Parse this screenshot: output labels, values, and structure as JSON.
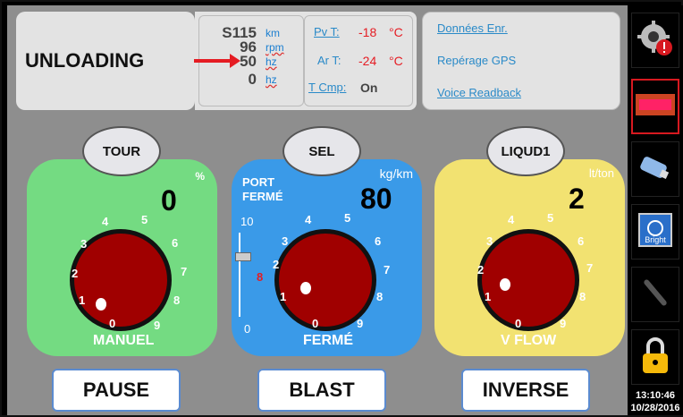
{
  "status": {
    "mode": "UNLOADING"
  },
  "readouts": {
    "speed_value": "S115",
    "speed_unit": "km",
    "rpm_value": "96",
    "rpm_unit": "rpm",
    "hz_value": "50",
    "hz_unit": "hz",
    "hz2_value": "0",
    "hz2_unit": "hz",
    "pvt_label": "Pv T:",
    "pvt_value": "-18",
    "pvt_unit": "°C",
    "art_label": "Ar T:",
    "art_value": "-24",
    "art_unit": "°C",
    "tcmp_label": "T Cmp:",
    "tcmp_value": "On"
  },
  "links": {
    "data": "Données Enr.",
    "gps": "Repérage GPS",
    "voice": "Voice Readback"
  },
  "sidebar": {
    "time": "13:10:46",
    "date": "10/28/2016"
  },
  "panels": {
    "tour": {
      "title": "TOUR",
      "unit": "%",
      "value": "0",
      "bottom": "MANUEL",
      "dial": [
        "0",
        "1",
        "2",
        "3",
        "4",
        "5",
        "6",
        "7",
        "8",
        "9"
      ]
    },
    "sel": {
      "title": "SEL",
      "unit": "kg/km",
      "value": "80",
      "top_line1": "PORT",
      "top_line2": "FERMÉ",
      "bottom": "FERMÉ",
      "scale_top": "10",
      "scale_bottom": "0",
      "slider_value": "8",
      "dial": [
        "0",
        "1",
        "2",
        "3",
        "4",
        "5",
        "6",
        "7",
        "8",
        "9"
      ]
    },
    "liquid": {
      "title": "LIQUD1",
      "unit": "lt/ton",
      "value": "2",
      "bottom": "V FLOW",
      "dial": [
        "0",
        "1",
        "2",
        "3",
        "4",
        "5",
        "6",
        "7",
        "8",
        "9"
      ]
    }
  },
  "actions": {
    "pause": "PAUSE",
    "blast": "BLAST",
    "inverse": "INVERSE"
  }
}
